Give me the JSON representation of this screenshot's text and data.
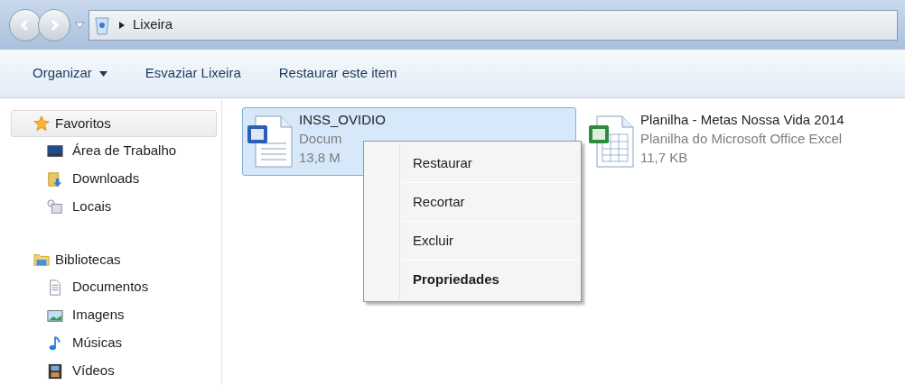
{
  "address_bar": {
    "path": [
      "Lixeira"
    ]
  },
  "toolbar": [
    {
      "label": "Organizar",
      "dropdown": true
    },
    {
      "label": "Esvaziar Lixeira",
      "dropdown": false
    },
    {
      "label": "Restaurar este item",
      "dropdown": false
    }
  ],
  "sidebar": {
    "groups": [
      {
        "label": "Favoritos",
        "kind": "star",
        "selected": true,
        "children": [
          {
            "label": "Área de Trabalho",
            "kind": "desktop",
            "selected": false
          },
          {
            "label": "Downloads",
            "kind": "downloads",
            "selected": false
          },
          {
            "label": "Locais",
            "kind": "recent",
            "selected": false
          }
        ]
      },
      {
        "label": "Bibliotecas",
        "kind": "library",
        "selected": false,
        "children": [
          {
            "label": "Documentos",
            "kind": "document",
            "selected": false
          },
          {
            "label": "Imagens",
            "kind": "image",
            "selected": false
          },
          {
            "label": "Músicas",
            "kind": "music",
            "selected": false
          },
          {
            "label": "Vídeos",
            "kind": "video",
            "selected": false
          }
        ]
      }
    ]
  },
  "files": [
    {
      "name": "INSS_OVIDIO",
      "type": "Docum",
      "size": "13,8 M",
      "kind": "word",
      "selected": true
    },
    {
      "name": "Planilha - Metas Nossa Vida 2014",
      "type": "Planilha do Microsoft Office Excel",
      "size": "11,7 KB",
      "kind": "excel",
      "selected": false
    }
  ],
  "context_menu": {
    "items": [
      {
        "label": "Restaurar",
        "default": false
      },
      {
        "label": "Recortar",
        "default": false
      },
      {
        "label": "Excluir",
        "default": false
      },
      {
        "label": "Propriedades",
        "default": true
      }
    ]
  }
}
